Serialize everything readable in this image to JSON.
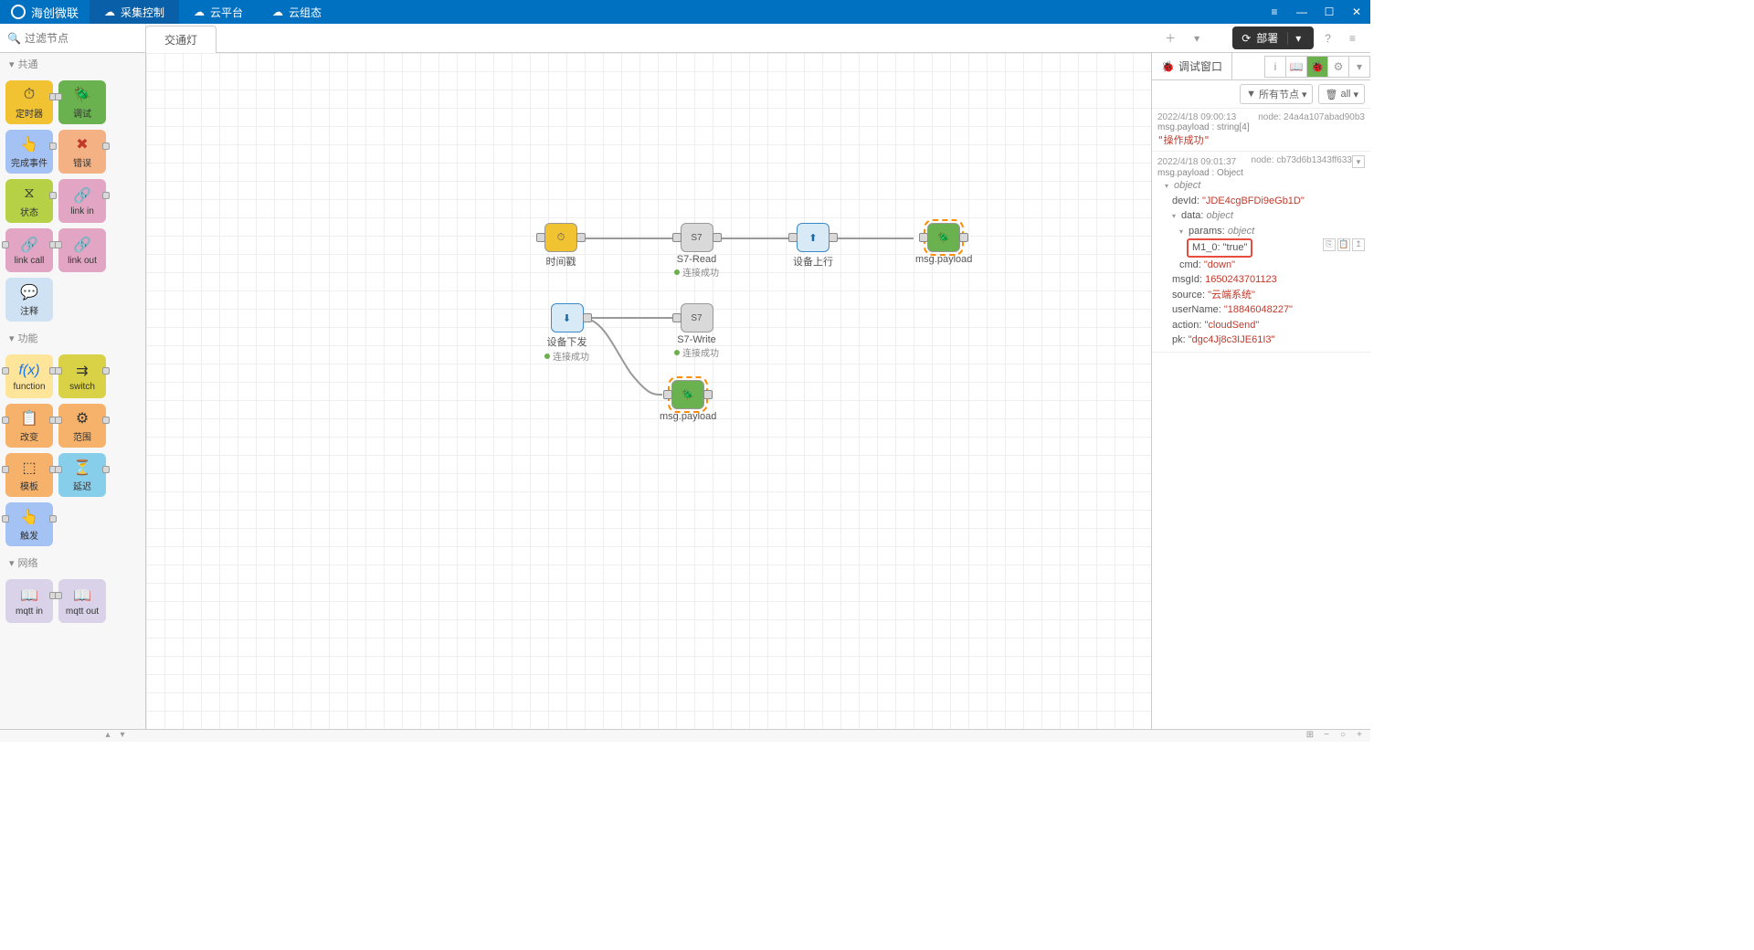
{
  "app_name": "海创微联",
  "top_menu": [
    "采集控制",
    "云平台",
    "云组态"
  ],
  "active_menu": 0,
  "search_placeholder": "过滤节点",
  "workspace_tab": "交通灯",
  "deploy_label": "部署",
  "palette": {
    "cat_common": "共通",
    "cat_func": "功能",
    "cat_net": "网络",
    "nodes": {
      "timer": "定时器",
      "debug": "调试",
      "complete": "完成事件",
      "error": "错误",
      "status": "状态",
      "linkin": "link in",
      "linkcall": "link call",
      "linkout": "link out",
      "comment": "注释",
      "function": "function",
      "switch": "switch",
      "change": "改变",
      "range": "范围",
      "template": "模板",
      "delay": "延迟",
      "trigger": "触发",
      "mqttin": "mqtt in",
      "mqttout": "mqtt out"
    }
  },
  "flow": {
    "n_time": {
      "label": "时间戳"
    },
    "n_s7r": {
      "label": "S7-Read",
      "sub": "连接成功"
    },
    "n_devup": {
      "label": "设备上行"
    },
    "n_dbg1": {
      "label": "msg.payload"
    },
    "n_devdn": {
      "label": "设备下发",
      "sub": "连接成功"
    },
    "n_s7w": {
      "label": "S7-Write",
      "sub": "连接成功"
    },
    "n_dbg2": {
      "label": "msg.payload"
    }
  },
  "sidebar": {
    "tab_label": "调试窗口",
    "filter_all_nodes": "所有节点",
    "filter_all": "all",
    "msg1": {
      "ts": "2022/4/18 09:00:13",
      "node": "node: 24a4a107abad90b3",
      "src": "msg.payload : string[4]",
      "val": "\"操作成功\""
    },
    "msg2": {
      "ts": "2022/4/18 09:01:37",
      "node": "node: cb73d6b1343ff633",
      "src": "msg.payload : Object",
      "obj_label": "object",
      "devId_k": "devId:",
      "devId_v": "\"JDE4cgBFDi9eGb1D\"",
      "data_k": "data:",
      "data_v": "object",
      "params_k": "params:",
      "params_v": "object",
      "m10": "M1_0: \"true\"",
      "cmd_k": "cmd:",
      "cmd_v": "\"down\"",
      "msgId_k": "msgId:",
      "msgId_v": "1650243701123",
      "source_k": "source:",
      "source_v": "\"云端系统\"",
      "user_k": "userName:",
      "user_v": "\"18846048227\"",
      "action_k": "action:",
      "action_v": "\"cloudSend\"",
      "pk_k": "pk:",
      "pk_v": "\"dgc4Jj8c3IJE61I3\""
    }
  },
  "colors": {
    "yellow": "#f1c232",
    "green": "#6ab150",
    "blue": "#a4c2f4",
    "pink": "#e2a6c4",
    "olive": "#b6d146",
    "orange": "#f6b26b",
    "teal": "#87ceeb",
    "lav": "#d9d2e9"
  }
}
